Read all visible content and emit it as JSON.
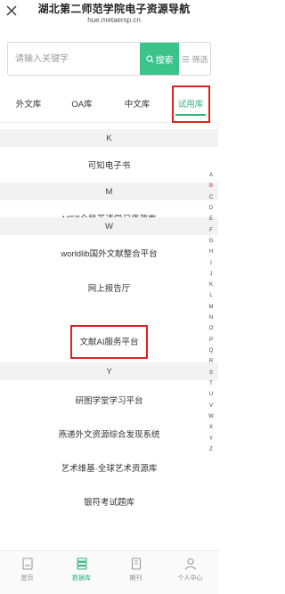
{
  "header": {
    "title": "湖北第二师范学院电子资源导航",
    "url": "hue.metaersp.cn"
  },
  "search": {
    "placeholder": "请输入关键字",
    "button_label": "搜索",
    "filter_label": "筛选"
  },
  "tabs": [
    {
      "label": "外文库",
      "active": false
    },
    {
      "label": "OA库",
      "active": false
    },
    {
      "label": "中文库",
      "active": false
    },
    {
      "label": "试用库",
      "active": true
    }
  ],
  "sections": [
    {
      "letter": "K",
      "items": [
        "可知电子书"
      ]
    },
    {
      "letter": "M",
      "items": [
        "MET全民英语学习资源库"
      ]
    },
    {
      "letter": "W",
      "items": [
        "worldlib国外文献整合平台",
        "网上报告厅",
        "文献AI服务平台"
      ]
    },
    {
      "letter": "Y",
      "items": [
        "研图学堂学习平台",
        "燕递外文资源综合发现系统",
        "艺术维基·全球艺术资源库",
        "银符考试题库"
      ]
    }
  ],
  "index_letters": [
    "A",
    "B",
    "C",
    "D",
    "E",
    "F",
    "G",
    "H",
    "I",
    "J",
    "K",
    "L",
    "M",
    "N",
    "O",
    "P",
    "Q",
    "R",
    "S",
    "T",
    "U",
    "V",
    "W",
    "X",
    "Y",
    "Z"
  ],
  "index_active": "B",
  "bottom_nav": [
    {
      "label": "首页",
      "icon": "home-icon",
      "active": false
    },
    {
      "label": "数据库",
      "icon": "database-icon",
      "active": true
    },
    {
      "label": "期刊",
      "icon": "journal-icon",
      "active": false
    },
    {
      "label": "个人中心",
      "icon": "user-icon",
      "active": false
    }
  ],
  "colors": {
    "accent": "#2db37a",
    "search_button": "#3cc38c",
    "highlight_box": "#e02020",
    "section_bg": "#f2f2f2"
  }
}
